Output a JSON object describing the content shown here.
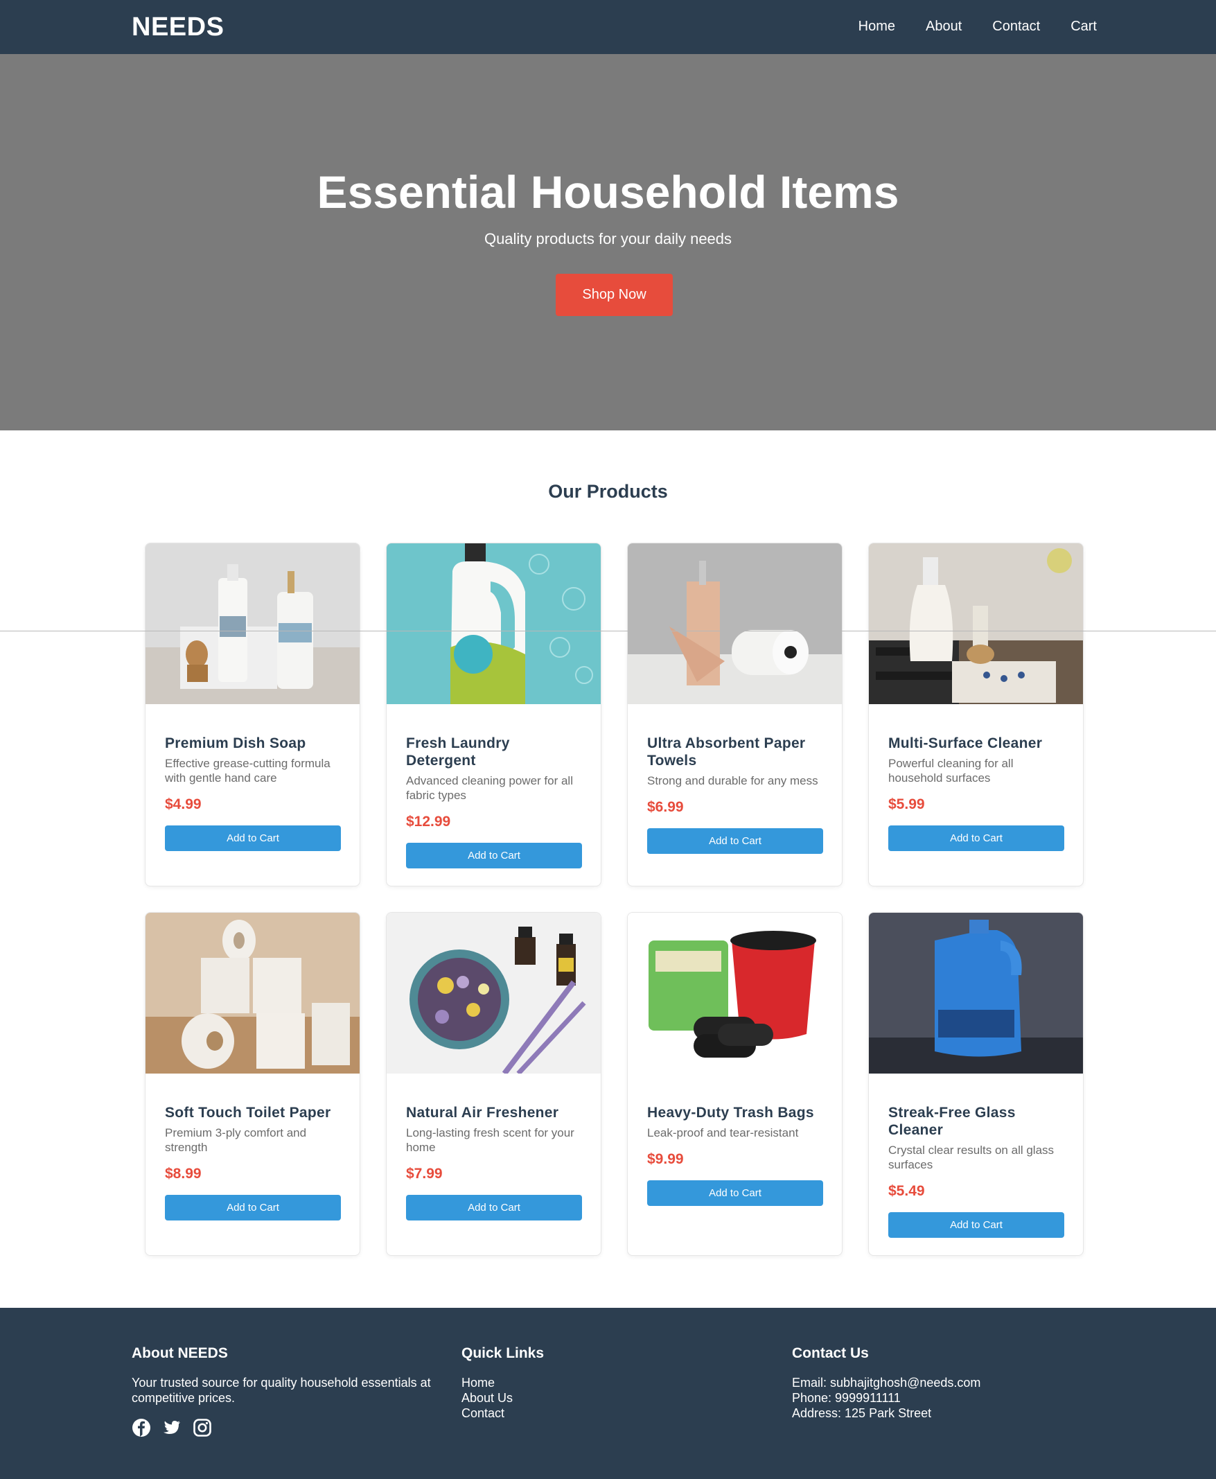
{
  "nav": {
    "logo": "NEEDS",
    "links": [
      "Home",
      "About",
      "Contact",
      "Cart"
    ]
  },
  "hero": {
    "title": "Essential Household Items",
    "subtitle": "Quality products for your daily needs",
    "cta": "Shop Now"
  },
  "products": {
    "title": "Our Products",
    "add_label": "Add to Cart",
    "items": [
      {
        "name": "Premium Dish Soap",
        "desc": "Effective grease-cutting formula with gentle hand care",
        "price": "$4.99",
        "image": "dish-soap-bottles"
      },
      {
        "name": "Fresh Laundry Detergent",
        "desc": "Advanced cleaning power for all fabric types",
        "price": "$12.99",
        "image": "laundry-detergent-bottle"
      },
      {
        "name": "Ultra Absorbent Paper Towels",
        "desc": "Strong and durable for any mess",
        "price": "$6.99",
        "image": "paper-towel-rolls"
      },
      {
        "name": "Multi-Surface Cleaner",
        "desc": "Powerful cleaning for all household surfaces",
        "price": "$5.99",
        "image": "spray-cleaner-bottle"
      },
      {
        "name": "Soft Touch Toilet Paper",
        "desc": "Premium 3-ply comfort and strength",
        "price": "$8.99",
        "image": "toilet-paper-rolls"
      },
      {
        "name": "Natural Air Freshener",
        "desc": "Long-lasting fresh scent for your home",
        "price": "$7.99",
        "image": "potpourri-bowl"
      },
      {
        "name": "Heavy-Duty Trash Bags",
        "desc": "Leak-proof and tear-resistant",
        "price": "$9.99",
        "image": "trash-bags-bin"
      },
      {
        "name": "Streak-Free Glass Cleaner",
        "desc": "Crystal clear results on all glass surfaces",
        "price": "$5.49",
        "image": "glass-cleaner-jug"
      }
    ]
  },
  "footer": {
    "about": {
      "title": "About NEEDS",
      "text": "Your trusted source for quality household essentials at competitive prices."
    },
    "links": {
      "title": "Quick Links",
      "items": [
        "Home",
        "About Us",
        "Contact"
      ]
    },
    "contact": {
      "title": "Contact Us",
      "email": "Email: subhajitghosh@needs.com",
      "phone": "Phone: 9999911111",
      "address": "Address: 125 Park Street"
    },
    "social": [
      "facebook-icon",
      "twitter-icon",
      "instagram-icon"
    ]
  },
  "colors": {
    "nav": "#2c3e50",
    "accent": "#e74c3c",
    "button": "#3498db",
    "hero": "#7b7b7b"
  }
}
